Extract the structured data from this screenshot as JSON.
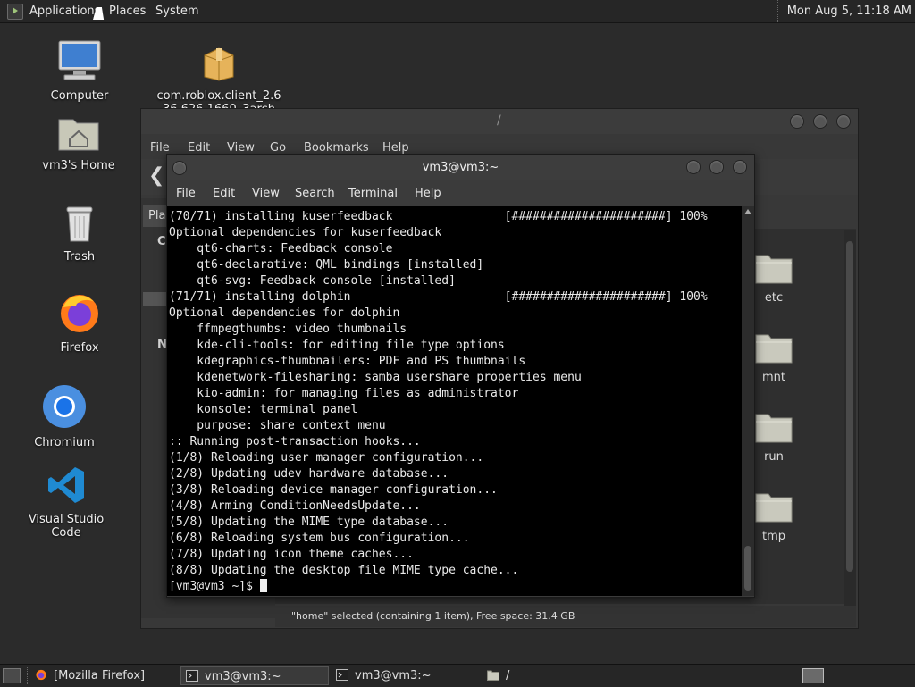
{
  "top_panel": {
    "menus": [
      "Applications",
      "Places",
      "System"
    ],
    "clock": "Mon Aug  5, 11:18 AM"
  },
  "desktop_icons": [
    {
      "label": "Computer",
      "icon": "computer-icon"
    },
    {
      "label": "com.roblox.client_2.636.626.1660_3arch",
      "icon": "package-icon"
    },
    {
      "label": "vm3's Home",
      "icon": "home-folder-icon"
    },
    {
      "label": "Trash",
      "icon": "trash-icon"
    },
    {
      "label": "Firefox",
      "icon": "firefox-icon"
    },
    {
      "label": "Chromium",
      "icon": "chromium-icon"
    },
    {
      "label": "Visual Studio Code",
      "icon": "vscode-icon"
    }
  ],
  "file_manager": {
    "title": "/",
    "menus": [
      "File",
      "Edit",
      "View",
      "Go",
      "Bookmarks",
      "Help"
    ],
    "places_tab": "Pla",
    "side_letters": [
      "C",
      "N"
    ],
    "folders": [
      "etc",
      "mnt",
      "run",
      "tmp"
    ],
    "status": "\"home\" selected (containing 1 item), Free space: 31.4 GB"
  },
  "terminal": {
    "title": "vm3@vm3:~",
    "menus": [
      "File",
      "Edit",
      "View",
      "Search",
      "Terminal",
      "Help"
    ],
    "lines": [
      "(70/71) installing kuserfeedback                [######################] 100%",
      "Optional dependencies for kuserfeedback",
      "    qt6-charts: Feedback console",
      "    qt6-declarative: QML bindings [installed]",
      "    qt6-svg: Feedback console [installed]",
      "(71/71) installing dolphin                      [######################] 100%",
      "Optional dependencies for dolphin",
      "    ffmpegthumbs: video thumbnails",
      "    kde-cli-tools: for editing file type options",
      "    kdegraphics-thumbnailers: PDF and PS thumbnails",
      "    kdenetwork-filesharing: samba usershare properties menu",
      "    kio-admin: for managing files as administrator",
      "    konsole: terminal panel",
      "    purpose: share context menu",
      ":: Running post-transaction hooks...",
      "(1/8) Reloading user manager configuration...",
      "(2/8) Updating udev hardware database...",
      "(3/8) Reloading device manager configuration...",
      "(4/8) Arming ConditionNeedsUpdate...",
      "(5/8) Updating the MIME type database...",
      "(6/8) Reloading system bus configuration...",
      "(7/8) Updating icon theme caches...",
      "(8/8) Updating the desktop file MIME type cache..."
    ],
    "prompt": "[vm3@vm3 ~]$ "
  },
  "taskbar": {
    "tasks": [
      {
        "label": "[Mozilla Firefox]",
        "icon": "firefox-icon"
      },
      {
        "label": "vm3@vm3:~",
        "icon": "terminal-icon"
      },
      {
        "label": "vm3@vm3:~",
        "icon": "terminal-icon"
      },
      {
        "label": "/",
        "icon": "folder-icon"
      }
    ]
  }
}
